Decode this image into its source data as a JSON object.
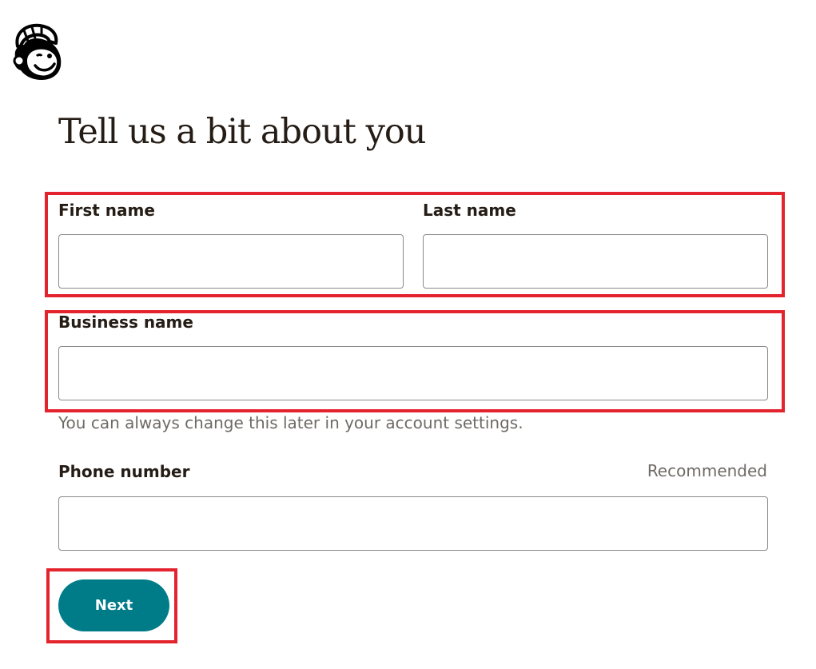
{
  "brand": {
    "logo_icon": "mailchimp-freddie-icon"
  },
  "page": {
    "title": "Tell us a bit about you"
  },
  "form": {
    "first_name": {
      "label": "First name",
      "value": "",
      "placeholder": ""
    },
    "last_name": {
      "label": "Last name",
      "value": "",
      "placeholder": ""
    },
    "business_name": {
      "label": "Business name",
      "value": "",
      "placeholder": "",
      "helper": "You can always change this later in your account settings."
    },
    "phone_number": {
      "label": "Phone number",
      "optional_tag": "Recommended",
      "value": "",
      "placeholder": ""
    },
    "next_button": {
      "label": "Next"
    }
  },
  "colors": {
    "accent": "#007c89",
    "annotation": "#e3232d",
    "text": "#241c15",
    "muted_text": "#6e6a65"
  }
}
